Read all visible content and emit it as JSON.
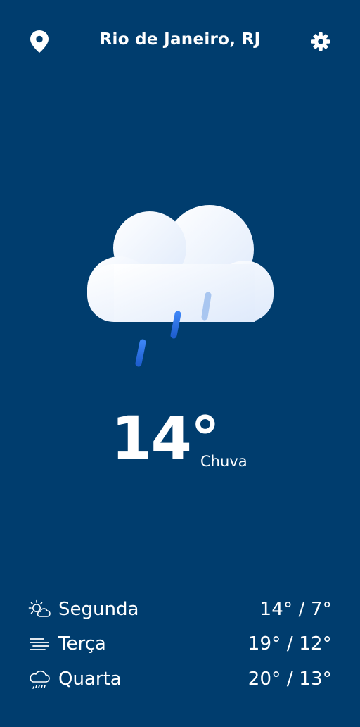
{
  "header": {
    "city": "Rio de Janeiro, RJ",
    "location_icon": "map-pin-icon",
    "settings_icon": "gear-icon"
  },
  "current": {
    "temperature": "14°",
    "condition": "Chuva",
    "icon": "cloud-rain-icon"
  },
  "forecast": [
    {
      "day": "Segunda",
      "range": "14° / 7°",
      "icon": "sun-cloud-icon"
    },
    {
      "day": "Terça",
      "range": "19° / 12°",
      "icon": "fog-icon"
    },
    {
      "day": "Quarta",
      "range": "20° / 13°",
      "icon": "cloud-drizzle-icon"
    }
  ],
  "colors": {
    "background": "#003d6e",
    "text": "#ffffff",
    "rain": "#2f74e8"
  }
}
